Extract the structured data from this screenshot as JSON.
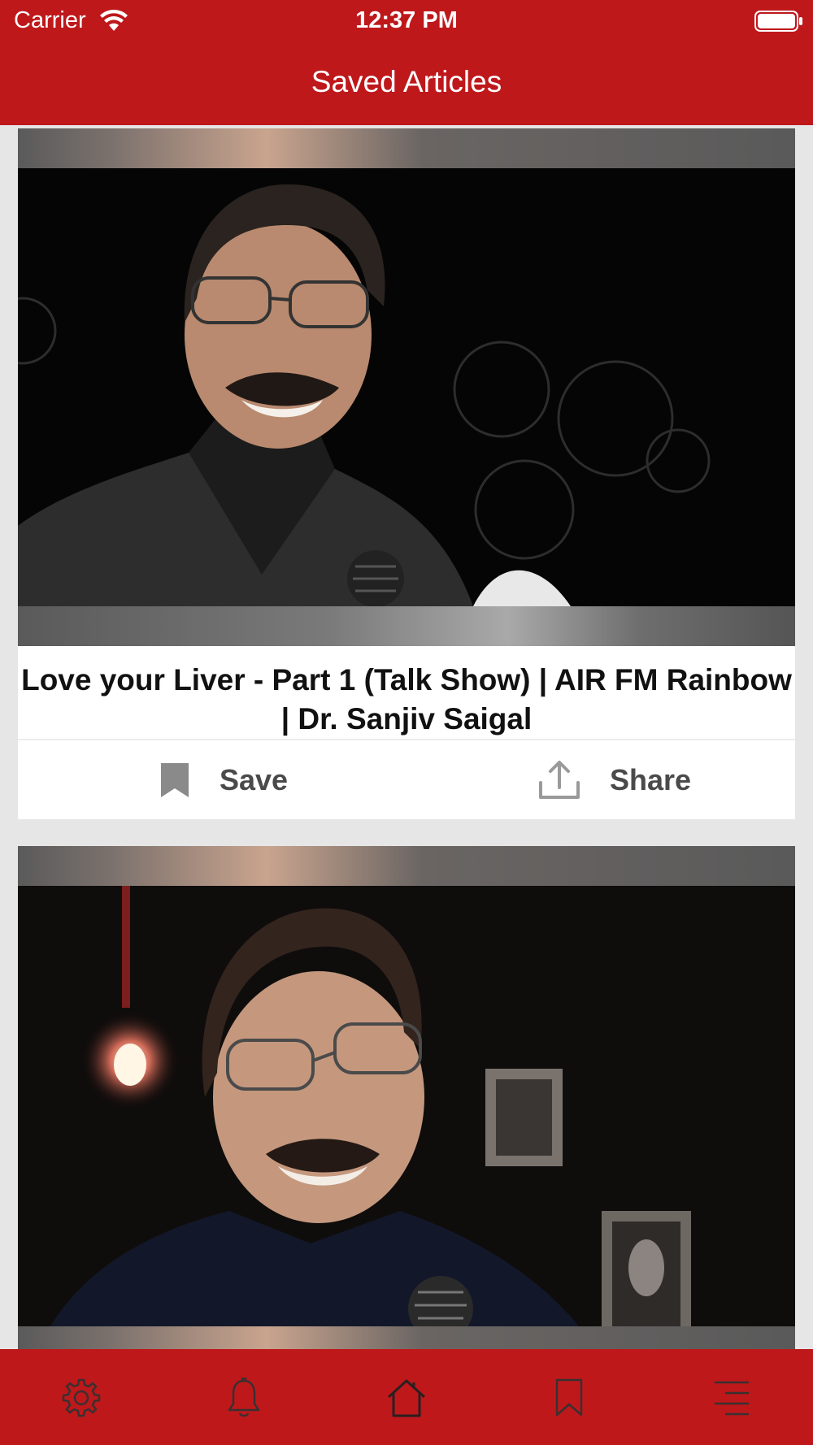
{
  "status_bar": {
    "carrier": "Carrier",
    "time": "12:37 PM"
  },
  "header": {
    "title": "Saved Articles"
  },
  "articles": [
    {
      "title": "Love your Liver - Part 1 (Talk Show) | AIR FM Rainbow | Dr. Sanjiv Saigal",
      "save_label": "Save",
      "share_label": "Share"
    },
    {
      "title": ""
    }
  ],
  "tab_bar": {
    "items": [
      "gear-icon",
      "bell-icon",
      "home-icon",
      "bookmark-icon",
      "menu-icon"
    ]
  },
  "colors": {
    "brand_red": "#be181b",
    "background": "#e6e6e6"
  }
}
